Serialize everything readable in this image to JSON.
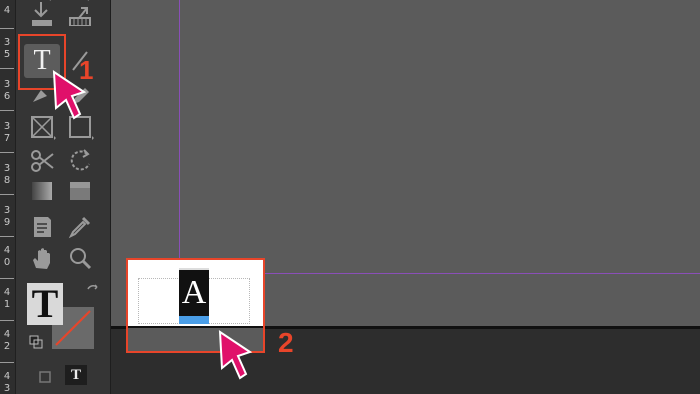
{
  "ruler": {
    "numbers": [
      "4",
      "3",
      "5",
      "3",
      "6",
      "3",
      "7",
      "3",
      "8",
      "3",
      "9",
      "4",
      "0",
      "4",
      "1",
      "4",
      "2",
      "4",
      "3"
    ]
  },
  "toolbar": {
    "type_tool_glyph": "T",
    "big_type_glyph": "T",
    "mini_type_glyph": "T"
  },
  "annotations": {
    "step1": "1",
    "step2": "2"
  },
  "frame": {
    "glyph": "A"
  },
  "colors": {
    "highlight": "#e8452a",
    "cursor": "#e0106a",
    "guide": "#8a4fb8",
    "selection": "#4a9ee8"
  }
}
